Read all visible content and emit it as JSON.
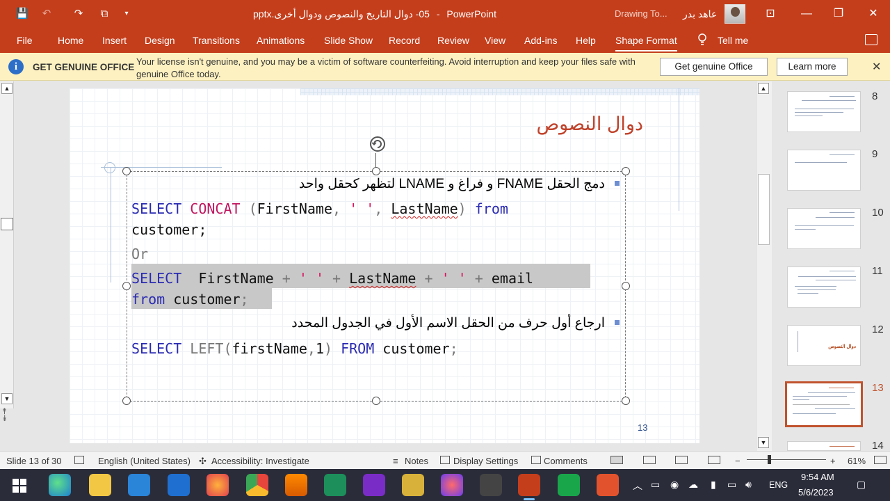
{
  "titlebar": {
    "filename": "05- دوال التاريخ والنصوص ودوال أخرى.pptx",
    "separator": "-",
    "app": "PowerPoint",
    "context": "Drawing To...",
    "user": "عاهد بدر",
    "quick_access": {
      "save": "💾",
      "undo": "↶",
      "redo": "↷",
      "present": "⧉",
      "more": "▾"
    },
    "window": {
      "restore_box": "⊡",
      "restore": "❐",
      "minimize": "—",
      "close": "✕"
    }
  },
  "ribbon": {
    "tabs": [
      "File",
      "Home",
      "Insert",
      "Design",
      "Transitions",
      "Animations",
      "Slide Show",
      "Record",
      "Review",
      "View",
      "Add-ins",
      "Help",
      "Shape Format",
      "Tell me"
    ]
  },
  "license": {
    "title": "GET GENUINE OFFICE",
    "message": "Your license isn't genuine, and you may be a victim of software counterfeiting. Avoid interruption and keep your files safe with genuine Office today.",
    "button_primary": "Get genuine Office",
    "button_secondary": "Learn more",
    "close": "✕",
    "info": "i"
  },
  "slide": {
    "title": "دوال النصوص",
    "bullet1": "دمج الحقل FNAME و فراغ و LNAME لتظهر كحقل واحد",
    "bullet2": "ارجاع أول حرف من الحقل الاسم الأول في الجدول المحدد",
    "or": "Or",
    "number": "13",
    "code": {
      "select": "SELECT",
      "concat": "CONCAT",
      "paren_open": " (",
      "firstname": "FirstName",
      "comma": ",",
      "space_str": "' '",
      "lastname": "LastName",
      "paren_close": ")",
      "from_lower": "from",
      "customer": "customer",
      "customer_semi": "customer;",
      "plus": "+",
      "email": "email",
      "from_upper": "FROM",
      "left": "LEFT",
      "left_args_open": "(",
      "firstname_lower": "firstName",
      "one": "1",
      "semi": ";"
    }
  },
  "thumbnails": {
    "numbers": [
      "8",
      "9",
      "10",
      "11",
      "12",
      "13",
      "14"
    ],
    "active": "13",
    "slide12_title": "دوال النصوص"
  },
  "statusbar": {
    "slide_info": "Slide 13 of 30",
    "language": "English (United States)",
    "accessibility": "Accessibility: Investigate",
    "notes": "Notes",
    "display": "Display Settings",
    "comments": "Comments",
    "zoom_minus": "−",
    "zoom_plus": "+",
    "zoom": "61%"
  },
  "taskbar": {
    "lang": "ENG",
    "time": "9:54 AM",
    "date": "5/6/2023"
  },
  "colors": {
    "accent": "#c43e1c",
    "keyword": "#2b2bb2",
    "function": "#c1155f",
    "slide_title": "#c0422a"
  }
}
